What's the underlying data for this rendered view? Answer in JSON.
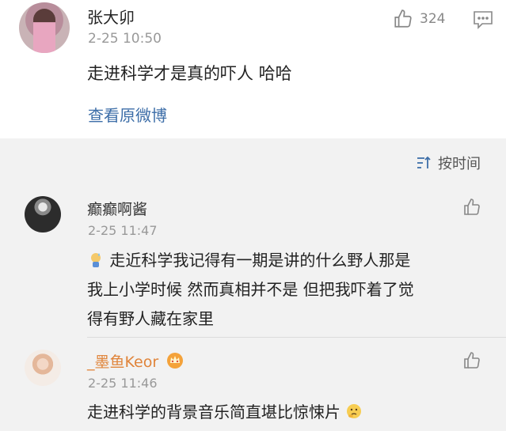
{
  "post": {
    "author": "张大卯",
    "time": "2-25 10:50",
    "likes": "324",
    "text": "走进科学才是真的吓人 哈哈",
    "view_original": "查看原微博"
  },
  "sort": {
    "label": "按时间"
  },
  "comments": [
    {
      "author": "癫癫啊酱",
      "time": "2-25 11:47",
      "line1": "走近科学我记得有一期是讲的什么野人那是",
      "line2": "我上小学时候 然而真相并不是 但把我吓着了觉",
      "line3": "得有野人藏在家里"
    },
    {
      "author": "_墨鱼Keor",
      "time": "2-25 11:46",
      "text": "走进科学的背景音乐简直堪比惊悚片"
    }
  ],
  "colors": {
    "link": "#3d6ea8",
    "muted": "#999999",
    "comment_bg": "#f2f2f2"
  },
  "icons": [
    "thumbs-up-icon",
    "comment-icon",
    "sort-icon",
    "sweat-emoji-icon",
    "crown-icon",
    "thinking-emoji-icon"
  ]
}
